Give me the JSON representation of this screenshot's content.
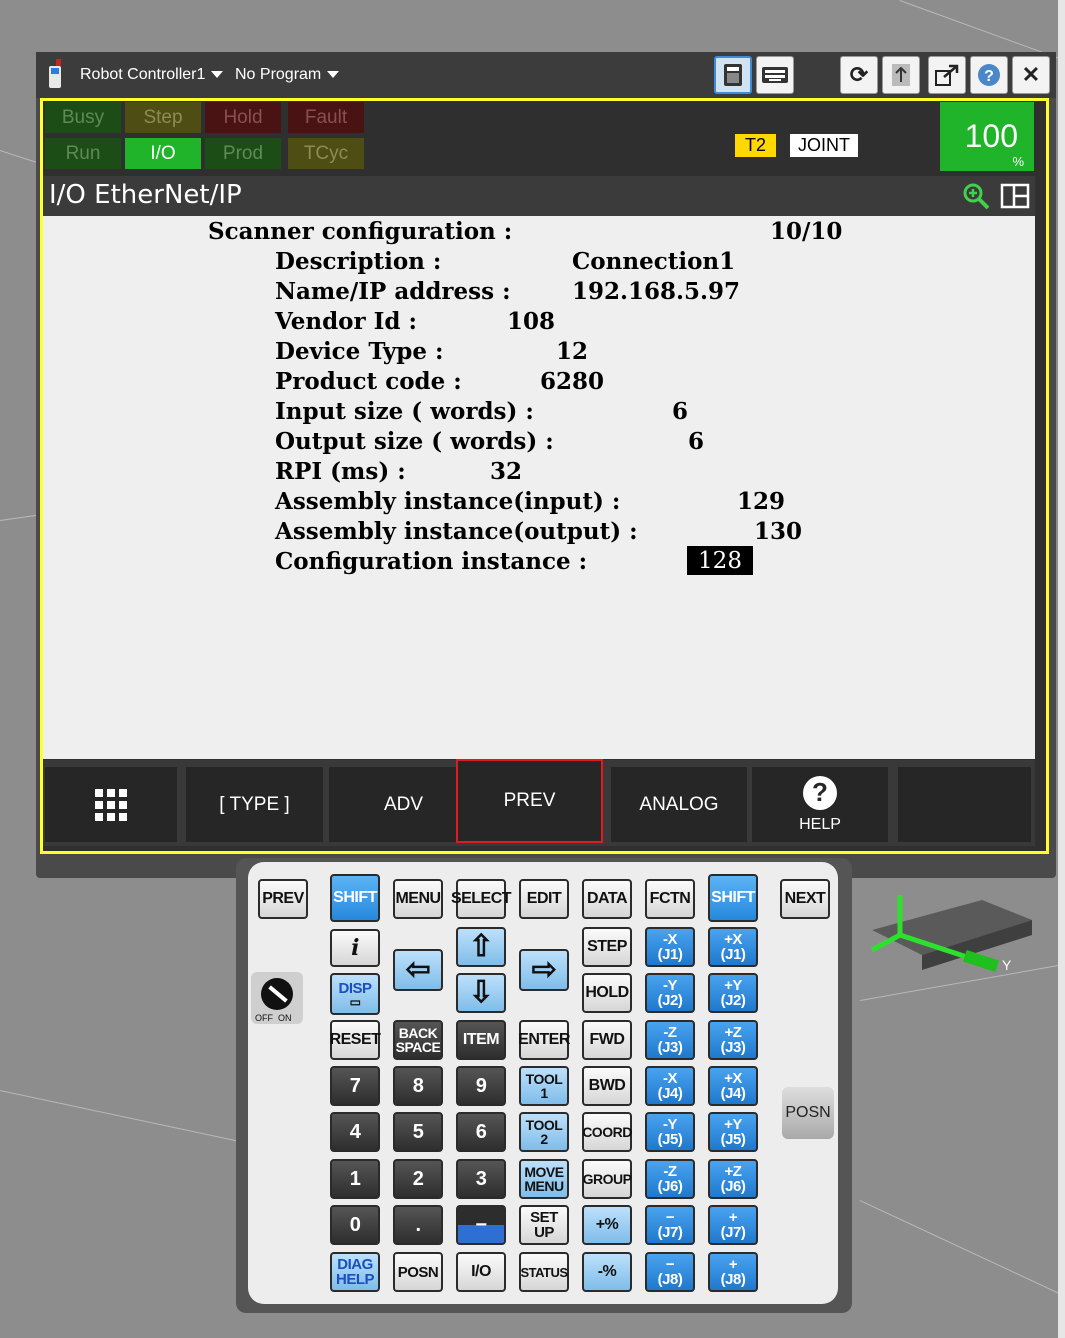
{
  "window": {
    "controller": "Robot Controller1",
    "program": "No Program"
  },
  "status": {
    "row1": [
      "Busy",
      "Step",
      "Hold",
      "Fault"
    ],
    "row2": [
      "Run",
      "I/O",
      "Prod",
      "TCyc"
    ],
    "active_indicator": "I/O",
    "mode": "T2",
    "coord": "JOINT",
    "override_value": "100",
    "override_unit": "%"
  },
  "menu": {
    "title": "I/O EtherNet/IP"
  },
  "config": {
    "header_label": "Scanner configuration :",
    "header_value": "10/10",
    "lines": [
      {
        "label": "Description :",
        "value": "Connection1"
      },
      {
        "label": "Name/IP address :",
        "value": "192.168.5.97"
      },
      {
        "label": "Vendor Id :",
        "value": "108"
      },
      {
        "label": "Device Type :",
        "value": "12"
      },
      {
        "label": "Product code :",
        "value": "6280"
      },
      {
        "label": "Input size ( words) :",
        "value": "6"
      },
      {
        "label": "Output size ( words) :",
        "value": "6"
      },
      {
        "label": "RPI (ms) :",
        "value": "32"
      },
      {
        "label": "Assembly instance(input) :",
        "value": "129"
      },
      {
        "label": "Assembly instance(output) :",
        "value": "130"
      },
      {
        "label": "Configuration instance :",
        "value": "128"
      }
    ]
  },
  "function_keys": [
    "",
    "[ TYPE ]",
    "ADV",
    "PREV",
    "ANALOG",
    "HELP",
    ""
  ],
  "highlighted_key": "PREV",
  "keypad": {
    "top_row": [
      "PREV",
      "SHIFT",
      "MENU",
      "SELECT",
      "EDIT",
      "DATA",
      "FCTN",
      "SHIFT",
      "NEXT"
    ],
    "info": "i",
    "disp": "DISP",
    "step": "STEP",
    "hold": "HOLD",
    "fwd": "FWD",
    "bwd": "BWD",
    "coord": "COORD",
    "group": "GROUP",
    "reset": "RESET",
    "backspace": "BACK\nSPACE",
    "item": "ITEM",
    "enter": "ENTER",
    "tool1": "TOOL\n1",
    "tool2": "TOOL\n2",
    "move_menu": "MOVE\nMENU",
    "setup": "SET\nUP",
    "digits": [
      "7",
      "8",
      "9",
      "4",
      "5",
      "6",
      "1",
      "2",
      "3",
      "0",
      "."
    ],
    "minus_comma": "−",
    "diag_help": "DIAG\nHELP",
    "posn": "POSN",
    "io": "I/O",
    "status": "STATUS",
    "plus_pct": "+%",
    "minus_pct": "-%",
    "jog_neg": [
      "-X\n(J1)",
      "-Y\n(J2)",
      "-Z\n(J3)",
      "-X\n(J4)",
      "-Y\n(J5)",
      "-Z\n(J6)",
      "−\n(J7)",
      "−\n(J8)"
    ],
    "jog_pos": [
      "+X\n(J1)",
      "+Y\n(J2)",
      "+Z\n(J3)",
      "+X\n(J4)",
      "+Y\n(J5)",
      "+Z\n(J6)",
      "+\n(J7)",
      "+\n(J8)"
    ],
    "posn_side": "POSN",
    "off_on": "OFF  ON"
  },
  "scene": {
    "axis_label": "Y"
  }
}
